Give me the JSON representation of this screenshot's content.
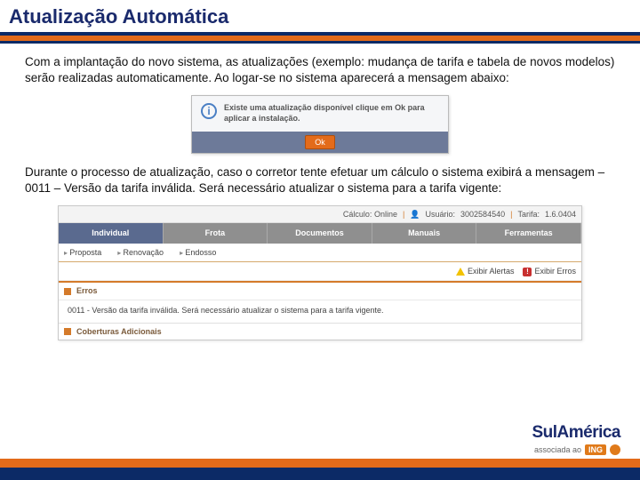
{
  "title": "Atualização Automática",
  "para1": "Com a implantação do novo sistema, as atualizações (exemplo: mudança de tarifa e tabela de novos modelos) serão realizadas automaticamente. Ao logar-se no sistema aparecerá a mensagem abaixo:",
  "popup": {
    "text": "Existe uma atualização disponível clique em Ok para aplicar a instalação.",
    "ok": "Ok"
  },
  "para2": "Durante o processo de atualização, caso o corretor tente efetuar um cálculo o sistema exibirá a mensagem – 0011 – Versão da tarifa inválida. Será necessário atualizar o sistema para a tarifa vigente:",
  "app": {
    "top": {
      "status": "Cálculo: Online",
      "user_label": "Usuário:",
      "user_value": "3002584540",
      "tarifa_label": "Tarifa:",
      "tarifa_value": "1.6.0404"
    },
    "tabs": {
      "t1": "Individual",
      "t2": "Frota",
      "t3": "Documentos",
      "t4": "Manuais",
      "t5": "Ferramentas"
    },
    "sub": {
      "s1": "Proposta",
      "s2": "Renovação",
      "s3": "Endosso"
    },
    "alerts": {
      "warn": "Exibir Alertas",
      "err": "Exibir Erros"
    },
    "section_err": "Erros",
    "err_msg": "0011 - Versão da tarifa inválida. Será necessário atualizar o sistema para a tarifa vigente.",
    "section_cov": "Coberturas Adicionais"
  },
  "brand": {
    "name": "SulAmérica",
    "assoc": "associada ao",
    "ing": "ING"
  }
}
